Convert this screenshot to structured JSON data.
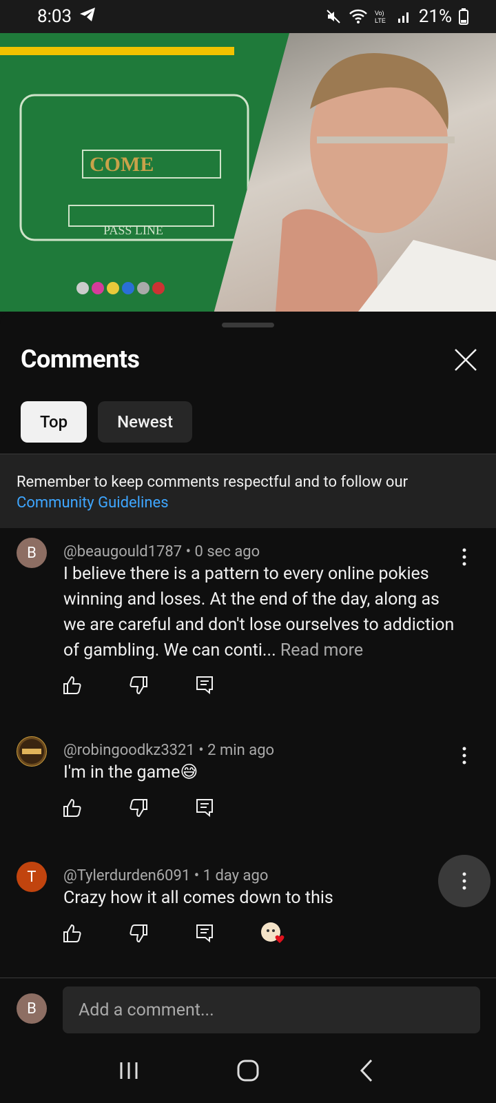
{
  "status": {
    "time": "8:03",
    "battery": "21%"
  },
  "video": {
    "left_panel": "craps table",
    "right_panel": "man thinking"
  },
  "sheet": {
    "title": "Comments",
    "close_icon": "close-icon"
  },
  "tabs": [
    {
      "label": "Top",
      "active": true
    },
    {
      "label": "Newest",
      "active": false
    }
  ],
  "notice": {
    "text": "Remember to keep comments respectful and to follow our",
    "link": "Community Guidelines"
  },
  "comments": [
    {
      "avatar_letter": "B",
      "avatar_color": "#8d6e63",
      "author": "@beaugould1787",
      "time": "0 sec ago",
      "text": "I believe there is a pattern to every online pokies winning and loses. At the end of the day, along as we are careful and don't lose ourselves to addiction of gambling. We can conti...",
      "read_more": "Read more"
    },
    {
      "avatar_letter": "",
      "avatar_color": "#6b4a1e",
      "author": "@robingoodkz3321",
      "time": "2 min ago",
      "text": "I'm in the game😅"
    },
    {
      "avatar_letter": "T",
      "avatar_color": "#c1440e",
      "author": "@Tylerdurden6091",
      "time": "1 day ago",
      "text": "Crazy how it all comes down to this"
    }
  ],
  "add_comment": {
    "avatar_letter": "B",
    "avatar_color": "#8d6e63",
    "placeholder": "Add a comment..."
  },
  "meta_sep": "•"
}
